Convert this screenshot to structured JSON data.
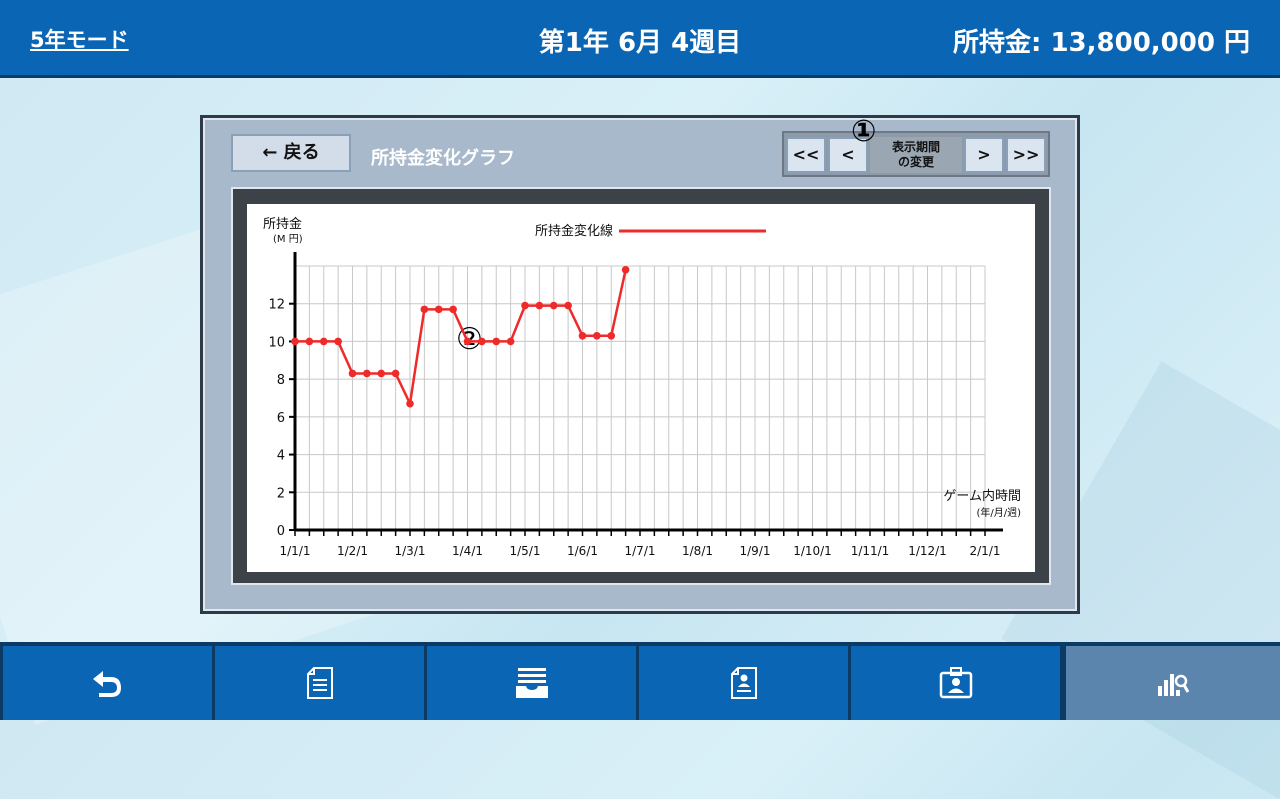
{
  "header": {
    "mode": "5年モード",
    "date": "第1年 6月 4週目",
    "money": "所持金: 13,800,000 円"
  },
  "panel": {
    "back_label": "← 戻る",
    "title": "所持金変化グラフ",
    "nav": {
      "first": "<<",
      "prev": "<",
      "period_line1": "表示期間",
      "period_line2": "の変更",
      "next": ">",
      "last": ">>"
    },
    "annotation1": "①",
    "annotation2": "②"
  },
  "chart_data": {
    "type": "line",
    "ylabel": "所持金",
    "yunit": "(M 円)",
    "xlabel": "ゲーム内時間",
    "xunit": "(年/月/週)",
    "ylim": [
      0,
      14
    ],
    "yticks": [
      0,
      2,
      4,
      6,
      8,
      10,
      12
    ],
    "xticks": [
      "1/1/1",
      "1/2/1",
      "1/3/1",
      "1/4/1",
      "1/5/1",
      "1/6/1",
      "1/7/1",
      "1/8/1",
      "1/9/1",
      "1/10/1",
      "1/11/1",
      "1/12/1",
      "2/1/1"
    ],
    "grid": true,
    "legend_position": "top-center",
    "series": [
      {
        "name": "所持金変化線",
        "color": "#ee2a2a",
        "x": [
          "1/1/1",
          "1/1/2",
          "1/1/3",
          "1/1/4",
          "1/2/1",
          "1/2/2",
          "1/2/3",
          "1/2/4",
          "1/3/1",
          "1/3/2",
          "1/3/3",
          "1/3/4",
          "1/4/1",
          "1/4/2",
          "1/4/3",
          "1/4/4",
          "1/5/1",
          "1/5/2",
          "1/5/3",
          "1/5/4",
          "1/6/1",
          "1/6/2",
          "1/6/3",
          "1/6/4"
        ],
        "values": [
          10.0,
          10.0,
          10.0,
          10.0,
          8.3,
          8.3,
          8.3,
          8.3,
          6.7,
          11.7,
          11.7,
          11.7,
          10.0,
          10.0,
          10.0,
          10.0,
          11.9,
          11.9,
          11.9,
          11.9,
          10.3,
          10.3,
          10.3,
          13.8
        ]
      }
    ]
  },
  "footer": {
    "buttons": [
      {
        "icon": "return-arrow-icon"
      },
      {
        "icon": "document-icon"
      },
      {
        "icon": "inbox-icon"
      },
      {
        "icon": "profile-document-icon"
      },
      {
        "icon": "id-card-icon"
      },
      {
        "icon": "chart-search-icon"
      }
    ]
  }
}
